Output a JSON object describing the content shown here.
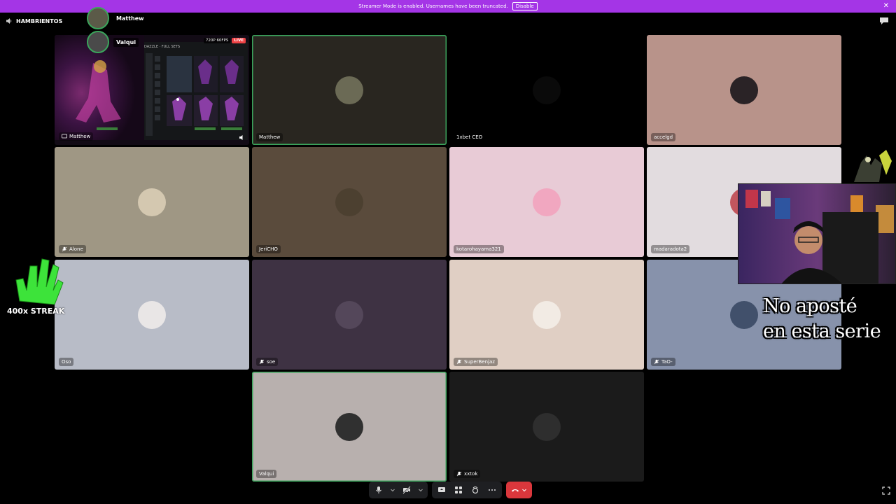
{
  "notice": {
    "message": "Streamer Mode is enabled. Usernames have been truncated.",
    "button": "Disable"
  },
  "channel": {
    "name": "HAMBRIENTOS",
    "icon": "speaker-icon"
  },
  "overlay": {
    "speakers": [
      {
        "name": "Matthew"
      },
      {
        "name": "Valqui"
      }
    ]
  },
  "stream_tile": {
    "name": "Matthew",
    "quality_badge": "720P 60FPS",
    "live_badge": "LIVE",
    "game_title": "DAZZLE · FULL SETS"
  },
  "tiles": [
    {
      "name": "Matthew",
      "bg": "#292620",
      "speaking": true,
      "muted": false,
      "avatar_color": "#6b6a55"
    },
    {
      "name": "1xbet CEO",
      "bg": "#000000",
      "speaking": false,
      "muted": false,
      "avatar_color": "#0a0a0a"
    },
    {
      "name": "accelgd",
      "bg": "#b8938a",
      "speaking": false,
      "muted": false,
      "avatar_color": "#2a2326"
    },
    {
      "name": "Alone",
      "bg": "#9f9784",
      "speaking": false,
      "muted": true,
      "avatar_color": "#d4c8b0"
    },
    {
      "name": "JeriCHO",
      "bg": "#5a4b3c",
      "speaking": false,
      "muted": false,
      "avatar_color": "#4c4030"
    },
    {
      "name": "kotarohayama321",
      "bg": "#e8cbd6",
      "speaking": false,
      "muted": false,
      "avatar_color": "#f1a7c0"
    },
    {
      "name": "madaradota2",
      "bg": "#e2dcdf",
      "speaking": false,
      "muted": false,
      "avatar_color": "#c2565e"
    },
    {
      "name": "Oso",
      "bg": "#b8bcc7",
      "speaking": false,
      "muted": false,
      "avatar_color": "#e9e6e6"
    },
    {
      "name": "soe",
      "bg": "#3e3243",
      "speaking": false,
      "muted": true,
      "avatar_color": "#54475a"
    },
    {
      "name": "SuperBenjaz",
      "bg": "#e0cfc4",
      "speaking": false,
      "muted": true,
      "avatar_color": "#f2ebe4"
    },
    {
      "name": "TaO-",
      "bg": "#8792ab",
      "speaking": false,
      "muted": true,
      "avatar_color": "#41506b"
    },
    {
      "name": "Valqui",
      "bg": "#b8b0ae",
      "speaking": true,
      "muted": false,
      "avatar_color": "#303030"
    },
    {
      "name": "xxtok",
      "bg": "#1b1b1b",
      "speaking": false,
      "muted": true,
      "avatar_color": "#2e2e2e"
    }
  ],
  "streak": {
    "text": "400x STREAK"
  },
  "caption": {
    "line1": "No aposté",
    "line2": "en esta serie"
  },
  "controls": {
    "icons": [
      "microphone-icon",
      "camera-off-icon",
      "screen-share-icon",
      "activities-icon",
      "soundboard-icon",
      "more-icon",
      "end-call-icon"
    ]
  },
  "colors": {
    "accent": "#a435e6",
    "speaking": "#3ba55c",
    "end_call": "#da373c"
  }
}
